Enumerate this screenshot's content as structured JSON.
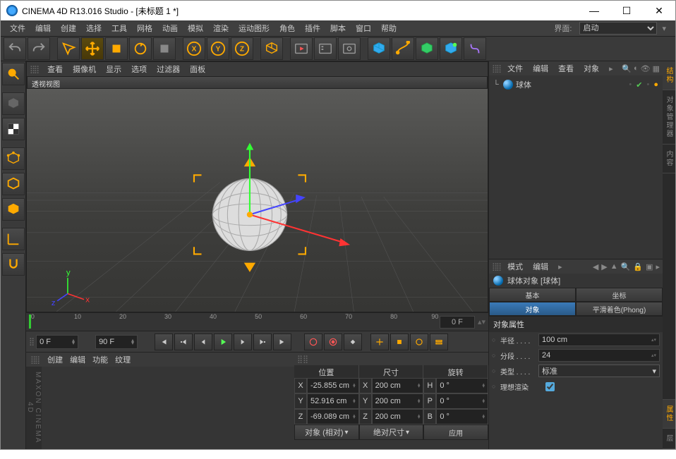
{
  "titlebar": {
    "text": "CINEMA 4D R13.016 Studio - [未标题 1 *]"
  },
  "menubar": {
    "items": [
      "文件",
      "编辑",
      "创建",
      "选择",
      "工具",
      "网格",
      "动画",
      "模拟",
      "渲染",
      "运动图形",
      "角色",
      "插件",
      "脚本",
      "窗口",
      "帮助"
    ],
    "interface_label": "界面:",
    "interface_value": "启动"
  },
  "viewport": {
    "menus": [
      "查看",
      "摄像机",
      "显示",
      "选项",
      "过滤器",
      "面板"
    ],
    "title": "透视视图"
  },
  "ruler": {
    "ticks": [
      "0",
      "10",
      "20",
      "30",
      "40",
      "50",
      "60",
      "70",
      "80",
      "90"
    ],
    "end": "0 F"
  },
  "playback": {
    "start": "0 F",
    "end": "90 F"
  },
  "material": {
    "menus": [
      "创建",
      "编辑",
      "功能",
      "纹理"
    ],
    "logo": "MAXON CINEMA 4D"
  },
  "coords": {
    "headers": [
      "位置",
      "尺寸",
      "旋转"
    ],
    "rows": [
      {
        "axis": "X",
        "pos": "-25.855 cm",
        "sizeL": "X",
        "size": "200 cm",
        "rotL": "H",
        "rot": "0 °"
      },
      {
        "axis": "Y",
        "pos": "52.916 cm",
        "sizeL": "Y",
        "size": "200 cm",
        "rotL": "P",
        "rot": "0 °"
      },
      {
        "axis": "Z",
        "pos": "-69.089 cm",
        "sizeL": "Z",
        "size": "200 cm",
        "rotL": "B",
        "rot": "0 °"
      }
    ],
    "btn1": "对象 (相对)",
    "btn2": "绝对尺寸",
    "btn3": "应用"
  },
  "objmgr": {
    "menus": [
      "文件",
      "编辑",
      "查看",
      "对象"
    ],
    "item": "球体"
  },
  "sidetabs": [
    "结构",
    "对象管理器",
    "内容"
  ],
  "attrmgr": {
    "menus": [
      "模式",
      "编辑"
    ],
    "title": "球体对象 [球体]",
    "tabs": [
      "基本",
      "坐标",
      "对象",
      "平滑着色(Phong)"
    ],
    "active_tab": 2,
    "section": "对象属性",
    "radius_label": "半径 . . . .",
    "radius": "100 cm",
    "seg_label": "分段 . . . .",
    "seg": "24",
    "type_label": "类型 . . . .",
    "type": "标准",
    "ideal_label": "理想渲染"
  },
  "sidetab_attr": "属性"
}
